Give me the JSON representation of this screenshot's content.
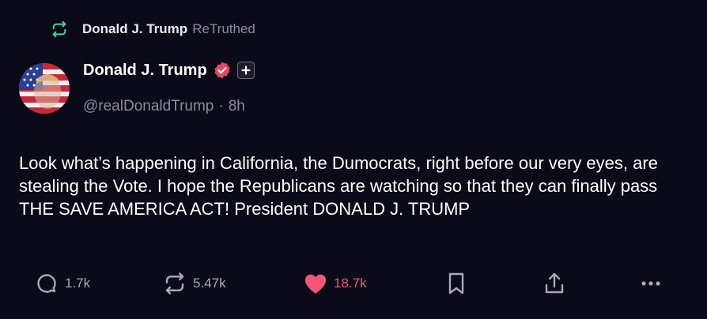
{
  "retruth": {
    "name": "Donald J. Trump",
    "suffix": "ReTruthed"
  },
  "author": {
    "name": "Donald J. Trump",
    "handle": "@realDonaldTrump",
    "separator": "·",
    "time": "8h",
    "verified": true
  },
  "post": {
    "text": "Look what’s happening in California, the Dumocrats, right before our very eyes, are stealing the Vote. I hope the Republicans are watching so that they can finally pass THE SAVE AMERICA ACT! President DONALD J. TRUMP"
  },
  "actions": {
    "replies": "1.7k",
    "retruths": "5.47k",
    "likes": "18.7k",
    "liked": true
  },
  "colors": {
    "background": "#0b0a18",
    "retruth_green": "#3fd6a4",
    "like_pink": "#f2557a",
    "muted_text": "#8d8b9c",
    "icon_gray": "#a9a7b8",
    "verified_red": "#e8455e"
  },
  "icons": {
    "retruth": "retruth-icon",
    "verified": "verified-badge-icon",
    "plus": "plus-icon",
    "reply": "reply-bubble-icon",
    "repost": "repost-icon",
    "like": "heart-icon",
    "bookmark": "bookmark-icon",
    "share": "share-icon",
    "more": "more-dots-icon"
  }
}
